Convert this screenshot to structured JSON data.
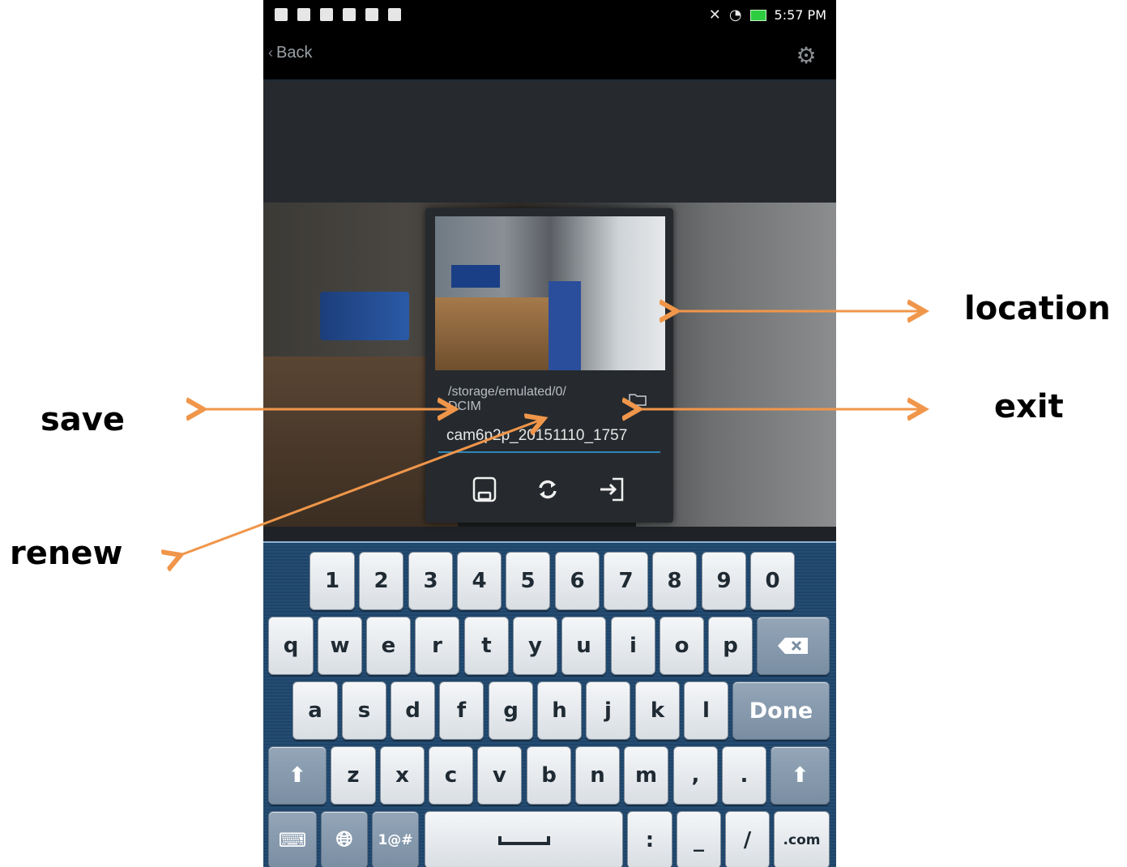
{
  "status_bar": {
    "time": "5:57 PM",
    "icons": [
      "notification-icon",
      "notification-icon",
      "keyboard-icon",
      "sd-card-icon",
      "gallery-icon",
      "upload-icon"
    ],
    "right_icons": [
      "mute-icon",
      "wifi-icon",
      "battery-icon"
    ]
  },
  "app_bar": {
    "back_label": "Back"
  },
  "dialog": {
    "path_line1": "/storage/emulated/0/",
    "path_line2": "DCIM",
    "filename_value": "cam6p2p_20151110_1757"
  },
  "keyboard": {
    "row1": [
      "1",
      "2",
      "3",
      "4",
      "5",
      "6",
      "7",
      "8",
      "9",
      "0"
    ],
    "row2": [
      "q",
      "w",
      "e",
      "r",
      "t",
      "y",
      "u",
      "i",
      "o",
      "p"
    ],
    "row3": [
      "a",
      "s",
      "d",
      "f",
      "g",
      "h",
      "j",
      "k",
      "l"
    ],
    "done_label": "Done",
    "row4": [
      "z",
      "x",
      "c",
      "v",
      "b",
      "n",
      "m",
      ",",
      "."
    ],
    "row5_symbols": "1@#",
    "row5_keys": [
      ":",
      "_",
      "/"
    ],
    "com_label": ".com"
  },
  "annotations": {
    "location": "location",
    "save": "save",
    "exit": "exit",
    "renew": "renew"
  },
  "colors": {
    "arrow": "#f0964a",
    "accent_underline": "#2f86b7",
    "keyboard_bg": "#23476c"
  }
}
